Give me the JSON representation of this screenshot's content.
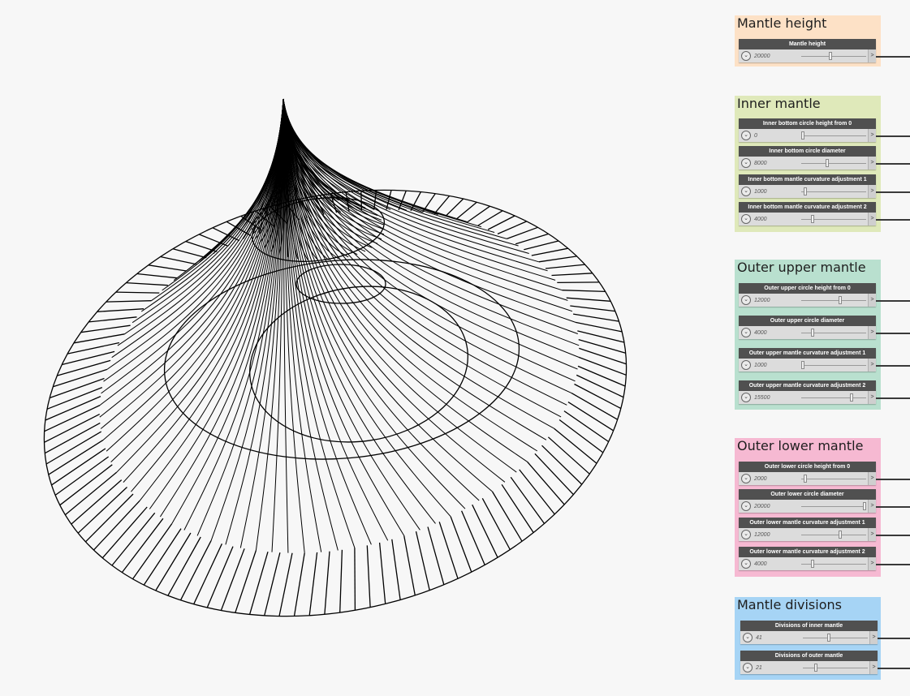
{
  "groups": [
    {
      "title": "Mantle height",
      "color": "#fde1c6",
      "sliders": [
        {
          "label": "Mantle height",
          "value": "20000",
          "position": 0.45
        }
      ]
    },
    {
      "title": "Inner mantle",
      "color": "#dfe9ba",
      "sliders": [
        {
          "label": "Inner bottom circle height from 0",
          "value": "0",
          "position": 0.02
        },
        {
          "label": "Inner bottom circle diameter",
          "value": "8000",
          "position": 0.4
        },
        {
          "label": "Inner bottom mantle curvature adjustment 1",
          "value": "1000",
          "position": 0.06
        },
        {
          "label": "Inner bottom mantle curvature adjustment 2",
          "value": "4000",
          "position": 0.17
        }
      ]
    },
    {
      "title": "Outer upper mantle",
      "color": "#b9e0cf",
      "sliders": [
        {
          "label": "Outer upper circle height from 0",
          "value": "12000",
          "position": 0.6
        },
        {
          "label": "Outer upper circle diameter",
          "value": "4000",
          "position": 0.17
        },
        {
          "label": "Outer upper mantle curvature adjustment 1",
          "value": "1000",
          "position": 0.02
        },
        {
          "label": "Outer upper mantle curvature adjustment 2",
          "value": "15500",
          "position": 0.78
        }
      ]
    },
    {
      "title": "Outer lower mantle",
      "color": "#f6b9d2",
      "sliders": [
        {
          "label": "Outer lower circle height from 0",
          "value": "2000",
          "position": 0.06
        },
        {
          "label": "Outer lower circle diameter",
          "value": "20000",
          "position": 0.98
        },
        {
          "label": "Outer lower mantle curvature adjustment 1",
          "value": "12000",
          "position": 0.6
        },
        {
          "label": "Outer lower mantle curvature adjustment 2",
          "value": "4000",
          "position": 0.17
        }
      ]
    },
    {
      "title": "Mantle divisions",
      "color": "#a6d4f5",
      "sliders": [
        {
          "label": "Divisions of inner mantle",
          "value": "41",
          "position": 0.4
        },
        {
          "label": "Divisions of outer mantle",
          "value": "21",
          "position": 0.2
        }
      ]
    }
  ],
  "icons": {
    "expander": "chevron-down-icon",
    "output_port": "greater-than-icon"
  }
}
